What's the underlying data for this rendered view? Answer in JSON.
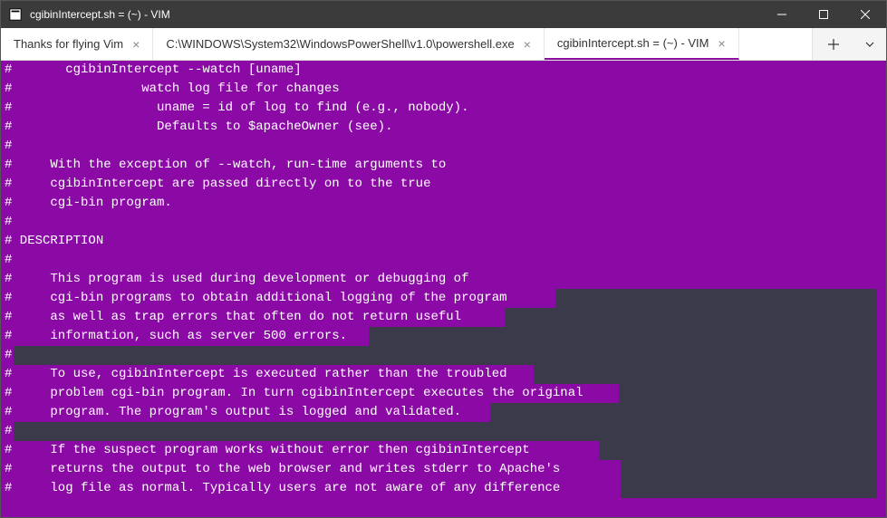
{
  "window": {
    "title": "cgibinIntercept.sh = (~) - VIM"
  },
  "tabs": [
    {
      "label": "Thanks for flying Vim",
      "active": false
    },
    {
      "label": "C:\\WINDOWS\\System32\\WindowsPowerShell\\v1.0\\powershell.exe",
      "active": false
    },
    {
      "label": "cgibinIntercept.sh = (~) - VIM",
      "active": true
    }
  ],
  "editor": {
    "lines": [
      "#       cgibinIntercept --watch [uname]",
      "#                 watch log file for changes",
      "#                   uname = id of log to find (e.g., nobody).",
      "#                   Defaults to $apacheOwner (see).",
      "#",
      "#     With the exception of --watch, run-time arguments to",
      "#     cgibinIntercept are passed directly on to the true",
      "#     cgi-bin program.",
      "#",
      "# DESCRIPTION",
      "#",
      "#     This program is used during development or debugging of",
      "#     cgi-bin programs to obtain additional logging of the program",
      "#     as well as trap errors that often do not return useful",
      "#     information, such as server 500 errors.",
      "#",
      "#     To use, cgibinIntercept is executed rather than the troubled",
      "#     problem cgi-bin program. In turn cgibinIntercept executes the original",
      "#     program. The program's output is logged and validated.",
      "#",
      "#     If the suspect program works without error then cgibinIntercept",
      "#     returns the output to the web browser and writes stderr to Apache's",
      "#     log file as normal. Typically users are not aware of any difference"
    ]
  }
}
